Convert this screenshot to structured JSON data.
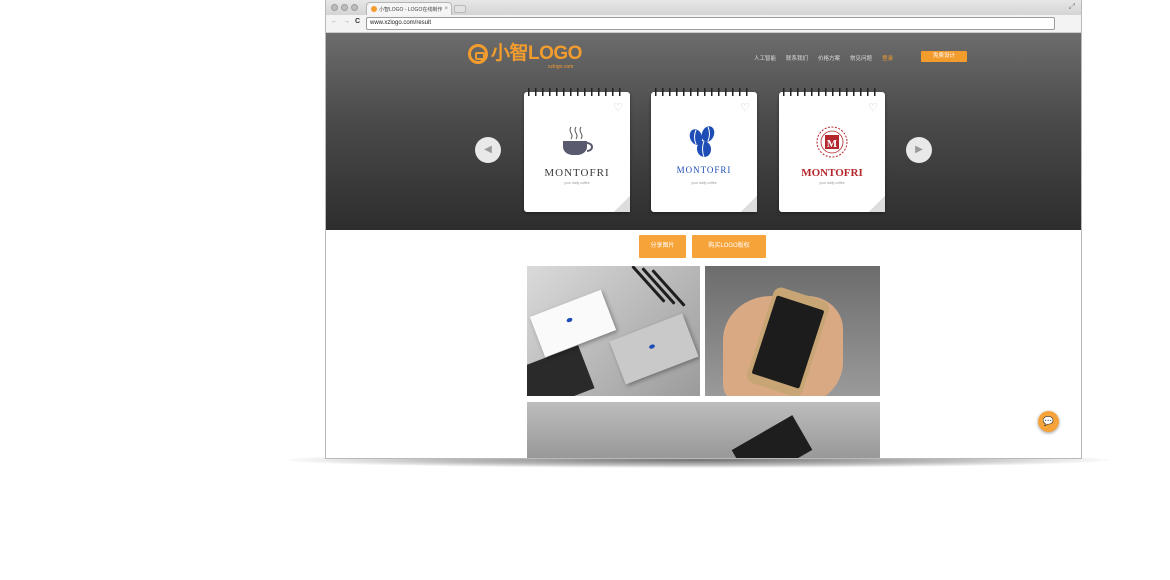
{
  "browser": {
    "tab_title": "小智LOGO - LOGO在线制作",
    "tab_close": "×",
    "window_control": "⤢",
    "address": "www.xzlogo.com/result"
  },
  "site": {
    "logo_text": "小智LOGO",
    "logo_sub": "xzlogo.com",
    "nav": [
      "人工智能",
      "联系我们",
      "价格方案",
      "常见问题",
      "登录"
    ],
    "nav_cta": "免费设计",
    "accent": "#f39c2e"
  },
  "carousel": {
    "prev_icon": "chevron-left-icon",
    "next_icon": "chevron-right-icon",
    "cards": [
      {
        "brand": "MONTOFRI",
        "tagline": "your daily coffee",
        "icon": "coffee-cup-icon",
        "color": "#3a3a3a"
      },
      {
        "brand": "MONTOFRI",
        "tagline": "your daily coffee",
        "icon": "coffee-beans-icon",
        "color": "#1e4db6"
      },
      {
        "brand": "MONTOFRI",
        "tagline": "your daily coffee",
        "icon": "m-emblem-icon",
        "color": "#b3282d"
      }
    ]
  },
  "actions": {
    "share": "分享图片",
    "buy": "购买LOGO版权"
  },
  "chat_icon": "chat-bubble-icon"
}
